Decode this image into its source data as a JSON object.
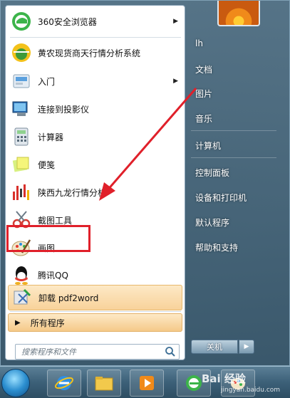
{
  "start_menu": {
    "programs": [
      {
        "label": "360安全浏览器",
        "icon": "360-browser-icon",
        "has_submenu": true
      },
      {
        "label": "黄农现货商天行情分析系统",
        "icon": "market-system-icon",
        "has_submenu": false
      },
      {
        "label": "入门",
        "icon": "getting-started-icon",
        "has_submenu": true
      },
      {
        "label": "连接到投影仪",
        "icon": "projector-icon",
        "has_submenu": false
      },
      {
        "label": "计算器",
        "icon": "calculator-icon",
        "has_submenu": false
      },
      {
        "label": "便笺",
        "icon": "sticky-notes-icon",
        "has_submenu": false
      },
      {
        "label": "陕西九龙行情分析",
        "icon": "chart-icon",
        "has_submenu": false
      },
      {
        "label": "截图工具",
        "icon": "snipping-tool-icon",
        "has_submenu": false
      },
      {
        "label": "画图",
        "icon": "paint-icon",
        "has_submenu": false
      },
      {
        "label": "腾讯QQ",
        "icon": "qq-icon",
        "has_submenu": false
      },
      {
        "label": "卸载 pdf2word",
        "icon": "uninstall-icon",
        "has_submenu": false
      }
    ],
    "all_programs_label": "所有程序",
    "search_placeholder": "搜索程序和文件",
    "right_items": [
      {
        "label": "lh"
      },
      {
        "label": "文档"
      },
      {
        "label": "图片"
      },
      {
        "label": "音乐"
      },
      {
        "label": "计算机"
      },
      {
        "label": "控制面板"
      },
      {
        "label": "设备和打印机"
      },
      {
        "label": "默认程序"
      },
      {
        "label": "帮助和支持"
      }
    ],
    "shutdown_label": "关机"
  },
  "watermark": {
    "main": "Bai 经验",
    "sub": "jingyan.baidu.com"
  },
  "colors": {
    "highlight": "#f8d29a",
    "annotation": "#e0202a"
  }
}
